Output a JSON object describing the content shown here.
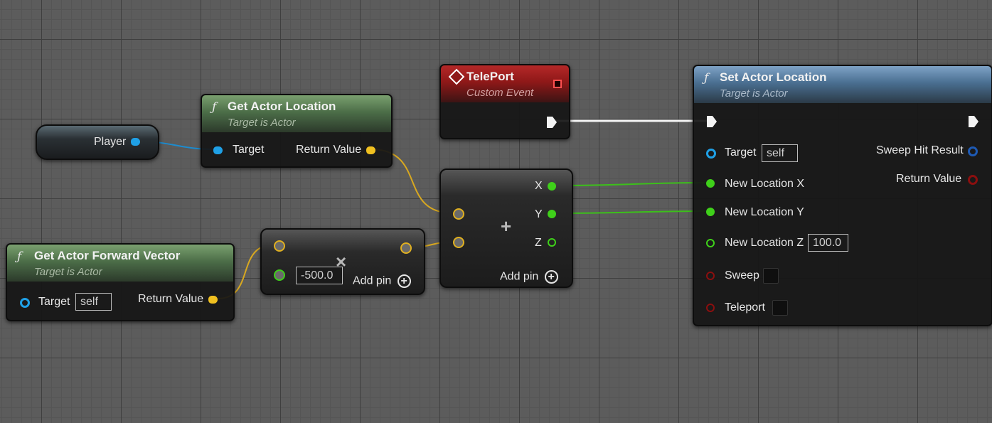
{
  "colors": {
    "object_pin": "#1fa0e6",
    "vector_pin": "#f0c020",
    "float_pin": "#3fd01a",
    "bool_pin": "#8b0f0f",
    "struct_pin": "#1e5ab4",
    "exec_pin": "#ffffff",
    "event_header": "#a41c1c",
    "function_header": "#4a6f91",
    "pure_header": "#4c6e48"
  },
  "player_node": {
    "label": "Player"
  },
  "get_actor_location": {
    "title": "Get Actor Location",
    "subtitle": "Target is Actor",
    "icon": "function-icon",
    "target_label": "Target",
    "return_label": "Return Value"
  },
  "get_forward_vector": {
    "title": "Get Actor Forward Vector",
    "subtitle": "Target is Actor",
    "icon": "function-icon",
    "target_label": "Target",
    "target_value": "self",
    "return_label": "Return Value"
  },
  "multiply_node": {
    "operator_icon": "multiply-icon",
    "operator": "×",
    "value": "-500.0",
    "add_pin_label": "Add pin"
  },
  "add_node": {
    "operator_icon": "plus-icon",
    "operator": "+",
    "x_label": "X",
    "y_label": "Y",
    "z_label": "Z",
    "add_pin_label": "Add pin"
  },
  "teleport_event": {
    "title": "TelePort",
    "subtitle": "Custom Event",
    "icon": "event-icon"
  },
  "set_actor_location": {
    "title": "Set Actor Location",
    "subtitle": "Target is Actor",
    "icon": "function-icon",
    "target_label": "Target",
    "target_value": "self",
    "new_x_label": "New Location X",
    "new_y_label": "New Location Y",
    "new_z_label": "New Location Z",
    "new_z_value": "100.0",
    "sweep_label": "Sweep",
    "teleport_label": "Teleport",
    "sweep_hit_label": "Sweep Hit Result",
    "return_label": "Return Value"
  }
}
